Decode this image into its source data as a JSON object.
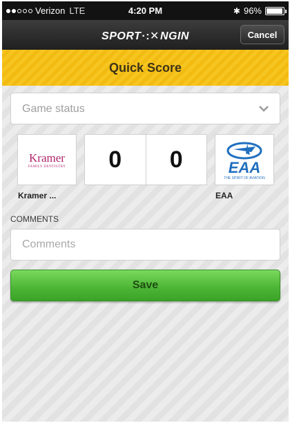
{
  "status_bar": {
    "carrier": "Verizon",
    "network": "LTE",
    "time": "4:20 PM",
    "battery": "96%",
    "battery_level": 0.96,
    "signal_bars_on": 2,
    "signal_bars_total": 5
  },
  "nav": {
    "logo_left": "SPORT",
    "logo_right": "NGIN",
    "cancel_label": "Cancel"
  },
  "header": {
    "title": "Quick Score"
  },
  "form": {
    "game_status": {
      "placeholder": "Game status",
      "value": ""
    },
    "home_team": {
      "name": "Kramer ...",
      "logo_text": "Kramer",
      "logo_subtext": "FAMILY DENTISTRY",
      "score": "0"
    },
    "away_team": {
      "name": "EAA",
      "logo_text": "EAA",
      "logo_subtext": "THE SPIRIT OF AVIATION",
      "score": "0"
    },
    "comments_label": "COMMENTS",
    "comments": {
      "placeholder": "Comments",
      "value": ""
    },
    "save_label": "Save"
  },
  "colors": {
    "accent_yellow": "#f7c51f",
    "save_green": "#4fb737",
    "nav_dark": "#2a2a2a"
  }
}
